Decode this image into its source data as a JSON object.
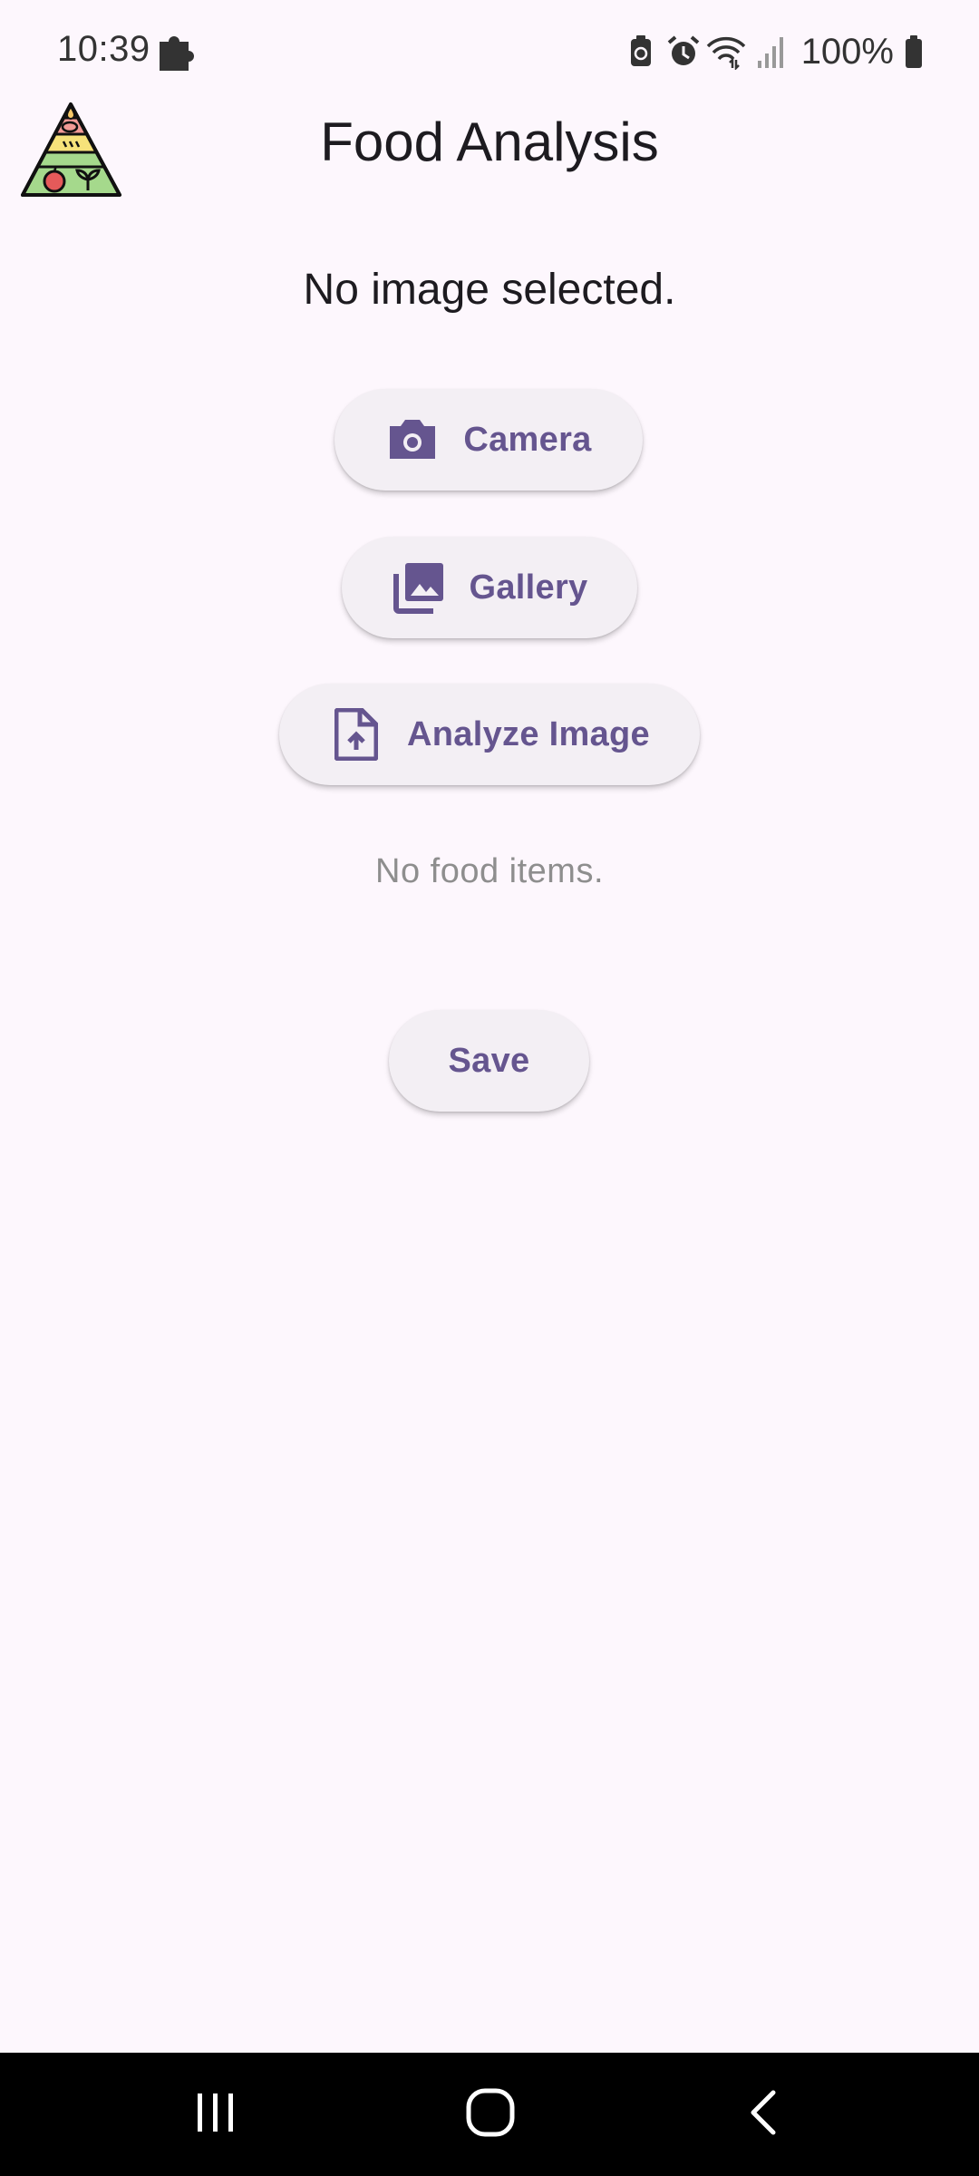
{
  "status_bar": {
    "time": "10:39",
    "battery_text": "100%",
    "icons": [
      "puzzle-icon",
      "battery-saver-icon",
      "alarm-icon",
      "wifi-icon",
      "signal-icon",
      "battery-icon"
    ]
  },
  "app_bar": {
    "title": "Food Analysis",
    "logo": "food-pyramid-logo"
  },
  "main": {
    "image_status": "No image selected.",
    "buttons": {
      "camera": {
        "label": "Camera",
        "icon": "camera-icon"
      },
      "gallery": {
        "label": "Gallery",
        "icon": "photo-library-icon"
      },
      "analyze": {
        "label": "Analyze Image",
        "icon": "upload-file-icon"
      },
      "save": {
        "label": "Save"
      }
    },
    "food_items_status": "No food items."
  },
  "navigation": {
    "items": [
      "recents-icon",
      "home-icon",
      "back-icon"
    ]
  },
  "colors": {
    "background": "#fdf7fd",
    "button_bg": "#f3eff4",
    "accent": "#65558f",
    "nav_bar": "#000000"
  }
}
